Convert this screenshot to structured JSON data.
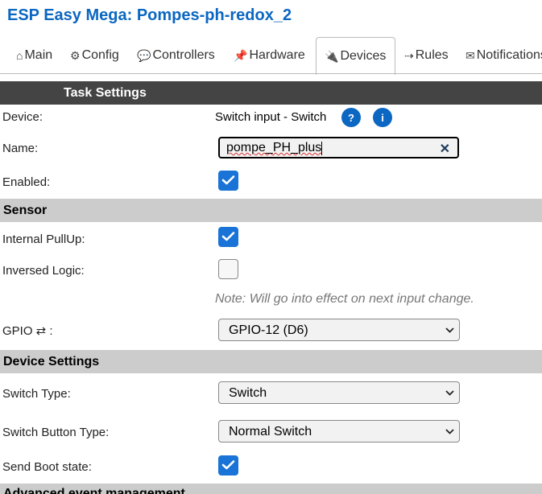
{
  "app": {
    "title": "ESP Easy Mega: Pompes-ph-redox_2"
  },
  "tabs": [
    {
      "label": "Main",
      "icon": "house-icon",
      "glyph": "⌂"
    },
    {
      "label": "Config",
      "icon": "gear-icon",
      "glyph": "⚙"
    },
    {
      "label": "Controllers",
      "icon": "chat-icon",
      "glyph": "💬"
    },
    {
      "label": "Hardware",
      "icon": "pin-icon",
      "glyph": "📌"
    },
    {
      "label": "Devices",
      "icon": "plug-icon",
      "glyph": "🔌"
    },
    {
      "label": "Rules",
      "icon": "arrow-icon",
      "glyph": "⇢"
    },
    {
      "label": "Notifications",
      "icon": "envelope-icon",
      "glyph": "✉"
    }
  ],
  "active_tab": "Devices",
  "task": {
    "header": "Task Settings",
    "device_label": "Device:",
    "device_value": "Switch input - Switch",
    "help_glyph": "?",
    "info_glyph": "i",
    "name_label": "Name:",
    "name_value": "pompe_PH_plus",
    "clear_glyph": "✕",
    "enabled_label": "Enabled:",
    "enabled": true
  },
  "sensor": {
    "header": "Sensor",
    "pullup_label": "Internal PullUp:",
    "pullup": true,
    "inversed_label": "Inversed Logic:",
    "inversed": false,
    "note": "Note: Will go into effect on next input change.",
    "gpio_label": "GPIO ⇄ :",
    "gpio_value": "GPIO-12 (D6)"
  },
  "device_settings": {
    "header": "Device Settings",
    "switch_type_label": "Switch Type:",
    "switch_type_value": "Switch",
    "button_type_label": "Switch Button Type:",
    "button_type_value": "Normal Switch",
    "boot_label": "Send Boot state:",
    "boot_state": true
  },
  "advanced": {
    "header": "Advanced event management"
  },
  "colors": {
    "accent": "#0b67c2",
    "checkbox": "#1a73d6",
    "header_dark": "#444444",
    "section_grey": "#cccccc"
  }
}
